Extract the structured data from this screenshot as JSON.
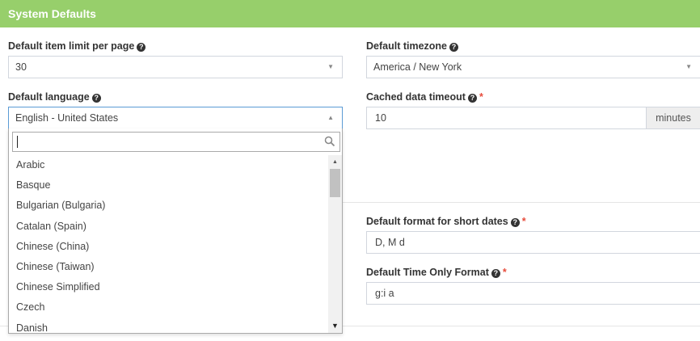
{
  "header": {
    "title": "System Defaults"
  },
  "fields": {
    "item_limit": {
      "label": "Default item limit per page",
      "value": "30"
    },
    "timezone": {
      "label": "Default timezone",
      "value": "America / New York"
    },
    "language": {
      "label": "Default language",
      "value": "English - United States"
    },
    "cache_timeout": {
      "label": "Cached data timeout",
      "value": "10",
      "unit": "minutes"
    },
    "short_date": {
      "label": "Default format for short dates",
      "value": "D, M d"
    },
    "time_only": {
      "label": "Default Time Only Format",
      "value": "g:i a"
    }
  },
  "dropdown": {
    "search_value": "",
    "options": [
      "Arabic",
      "Basque",
      "Bulgarian (Bulgaria)",
      "Catalan (Spain)",
      "Chinese (China)",
      "Chinese (Taiwan)",
      "Chinese Simplified",
      "Czech",
      "Danish"
    ]
  },
  "icons": {
    "help": "question-circle-icon",
    "caret_down": "chevron-down-icon",
    "caret_up": "chevron-up-icon",
    "search": "search-icon"
  },
  "colors": {
    "header_bg": "#97cf6b",
    "required": "#e74c3c",
    "focus_border": "#5b9bd5"
  }
}
